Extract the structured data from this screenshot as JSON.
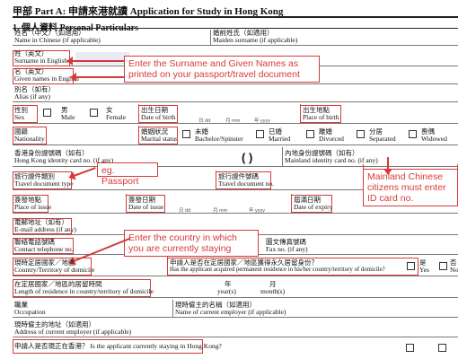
{
  "header": {
    "title": "甲部 Part A: 申請來港就讀 Application for Study in Hong Kong"
  },
  "section": {
    "title": "1.  個人資料 Personal Particulars"
  },
  "fields": {
    "chinese_name": [
      "姓名（中文）（如適用）",
      "Name in Chinese (if applicable)"
    ],
    "maiden": [
      "婚前姓氏（如適用）",
      "Maiden surname (if applicable)"
    ],
    "surname": [
      "姓（英文）",
      "Surname in English"
    ],
    "given": [
      "名（英文）",
      "Given names in English"
    ],
    "alias": [
      "別名（如有）",
      "Alias (if any)"
    ],
    "sex": [
      "性別",
      "Sex"
    ],
    "male": [
      "男",
      "Male"
    ],
    "female": [
      "女",
      "Female"
    ],
    "dob": [
      "出生日期",
      "Date of birth"
    ],
    "pob": [
      "出生地點",
      "Place of birth"
    ],
    "nationality": [
      "國籍",
      "Nationality"
    ],
    "marital": [
      "婚姻狀況",
      "Marital status"
    ],
    "bachelor": [
      "未婚",
      "Bachelor/Spinster"
    ],
    "married": [
      "已婚",
      "Married"
    ],
    "divorced": [
      "離婚",
      "Divorced"
    ],
    "separated": [
      "分居",
      "Separated"
    ],
    "widowed": [
      "喪偶",
      "Widowed"
    ],
    "hkid": [
      "香港身份證號碼（如有）",
      "Hong Kong identity card no. (if any)"
    ],
    "mainland_id": [
      "內地身份證號碼（如有）",
      "Mainland identity card no. (if any)"
    ],
    "travel_type": [
      "旅行證件類別",
      "Travel document type"
    ],
    "travel_no": [
      "旅行證件號碼",
      "Travel document no."
    ],
    "place_issue": [
      "簽發地點",
      "Place of issue"
    ],
    "date_issue": [
      "簽發日期",
      "Date of issue"
    ],
    "date_expiry": [
      "屆滿日期",
      "Date of expiry"
    ],
    "email": [
      "電郵地址（如有）",
      "E-mail address (if any)"
    ],
    "phone": [
      "聯絡電話號碼",
      "Contact telephone no."
    ],
    "fax": [
      "圖文傳真號碼",
      "Fax no. (if any)"
    ],
    "domicile": [
      "現時定居國家／地區",
      "Country/Territory of domicile"
    ],
    "permanent": [
      "申請人是否在定居國家／地區獲得永久居留身份？",
      "Has the applicant acquired permanent residence in his/her country/territory of domicile?"
    ],
    "yes": [
      "是",
      "Yes"
    ],
    "no": [
      "否",
      "No"
    ],
    "length": [
      "在定居國家／地區的居留時間",
      "Length of residence in country/territory of domicile"
    ],
    "year": [
      "年",
      "year(s)"
    ],
    "month": [
      "月",
      "month(s)"
    ],
    "occupation": [
      "職業",
      "Occupation"
    ],
    "employer_name": [
      "現時僱主的名稱（如適用）",
      "Name of current employer (if applicable)"
    ],
    "employer_addr": [
      "現時僱主的地址（如適用）",
      "Address of current employer (if applicable)"
    ],
    "staying": [
      "申請人是否現正在香港？ Is the applicant currently staying in Hong Kong?"
    ]
  },
  "date_units": [
    "日 dd",
    "月 mm",
    "年 yyyy"
  ],
  "hkid_parens": "(      )",
  "callouts": {
    "names": "Enter the Surname and Given Names as printed on your passport/travel document",
    "passport": "eg. Passport",
    "mainland": "Mainland Chinese citizens must enter ID card no.",
    "country": "Enter the country in which you are currently staying"
  },
  "colors": {
    "annotation": "#d63a3a",
    "shade": "#e9ecf4"
  }
}
